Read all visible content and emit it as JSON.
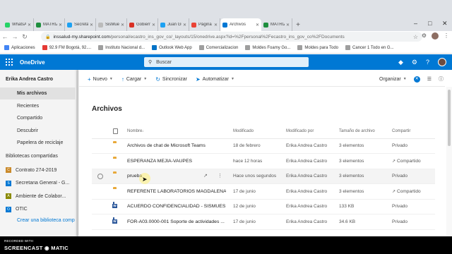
{
  "browser": {
    "tabs": [
      {
        "label": "WhatsAp",
        "color": "#25d366"
      },
      {
        "label": "MATRIZ",
        "color": "#1e8e3e"
      },
      {
        "label": "Secretari",
        "color": "#1da1f2"
      },
      {
        "label": "SisMuest",
        "color": "#bbbbbb"
      },
      {
        "label": "Gobierno",
        "color": "#d93025"
      },
      {
        "label": "Juan Guil",
        "color": "#1da1f2"
      },
      {
        "label": "Página p",
        "color": "#ea4335"
      },
      {
        "label": "Archivos",
        "color": "#0078d4"
      },
      {
        "label": "MATRIZ",
        "color": "#1e8e3e"
      }
    ],
    "active_tab_index": 7,
    "new_tab": "+",
    "url_host": "inssalud-my.sharepoint.com",
    "url_path": "/personal/ecastro_ins_gov_co/_layouts/15/onedrive.aspx?id=%2Fpersonal%2Fecastro_ins_gov_co%2FDocuments",
    "bookmarks": [
      {
        "label": "Aplicaciones",
        "color": "#4285f4"
      },
      {
        "label": "92.9 FM Bogotá, 92....",
        "color": "#e53935"
      },
      {
        "label": "Instituto Nacional d...",
        "color": "#9e9e9e"
      },
      {
        "label": "Outlook Web App",
        "color": "#0072c6"
      },
      {
        "label": "Comercializacion",
        "color": "#9e9e9e"
      },
      {
        "label": "Moldes Foamy Go...",
        "color": "#9e9e9e"
      },
      {
        "label": "Moldes para Todo",
        "color": "#9e9e9e"
      },
      {
        "label": "Cancer 1 Todo en G...",
        "color": "#9e9e9e"
      }
    ]
  },
  "suite": {
    "app_name": "OneDrive",
    "search_placeholder": "Buscar",
    "accent": "#0078d4"
  },
  "nav": {
    "user_name": "Erika Andrea Castro",
    "items": [
      {
        "label": "Mis archivos",
        "selected": true
      },
      {
        "label": "Recientes",
        "selected": false
      },
      {
        "label": "Compartido",
        "selected": false
      },
      {
        "label": "Descubrir",
        "selected": false
      },
      {
        "label": "Papelera de reciclaje",
        "selected": false
      }
    ],
    "shared_libraries_heading": "Bibliotecas compartidas",
    "sites": [
      {
        "label": "Contrato 274-2019",
        "letter": "C",
        "color": "#ca8a2b"
      },
      {
        "label": "Secretaria General - G...",
        "letter": "S",
        "color": "#0078d4"
      },
      {
        "label": "Ambiente de Colabor...",
        "letter": "A",
        "color": "#8a8a00"
      },
      {
        "label": "OTIC",
        "letter": "O",
        "color": "#0078d4"
      }
    ],
    "create_library": "Crear una biblioteca comp"
  },
  "commands": {
    "new": "Nuevo",
    "upload": "Cargar",
    "sync": "Sincronizar",
    "automate": "Automatizar",
    "sort": "Organizar"
  },
  "page_title": "Archivos",
  "columns": {
    "name": "Nombre",
    "modified": "Modificado",
    "modified_by": "Modificado por",
    "size": "Tamaño de archivo",
    "sharing": "Compartir"
  },
  "files": [
    {
      "type": "folder",
      "name": "Archivos de chat de Microsoft Teams",
      "modified": "18 de febrero",
      "by": "Erika Andrea Castro",
      "size": "3 elementos",
      "sharing": "Privado",
      "shared": false
    },
    {
      "type": "folder",
      "name": "ESPERANZA MEJÍA-VAUPÉS",
      "modified": "hace 12 horas",
      "by": "Erika Andrea Castro",
      "size": "3 elementos",
      "sharing": "Compartido",
      "shared": true
    },
    {
      "type": "folder",
      "name": "prueba",
      "modified": "Hace unos segundos",
      "by": "Erika Andrea Castro",
      "size": "3 elementos",
      "sharing": "Privado",
      "shared": false
    },
    {
      "type": "folder",
      "name": "REFERENTE LABORATORIOS MAGDALENA-...",
      "modified": "17 de junio",
      "by": "Erika Andrea Castro",
      "size": "3 elementos",
      "sharing": "Compartido",
      "shared": true
    },
    {
      "type": "word",
      "name": "ACUERDO CONFIDENCIALIDAD - SISMUES...",
      "modified": "12 de junio",
      "by": "Erika Andrea Castro",
      "size": "133 KB",
      "sharing": "Privado",
      "shared": false
    },
    {
      "type": "word",
      "name": "FOR-A03.0000-001 Soporte de actividades ...",
      "modified": "17 de junio",
      "by": "Erika Andrea Castro",
      "size": "34.6 KB",
      "sharing": "Privado",
      "shared": false
    }
  ],
  "watermark": {
    "line1": "RECORDED WITH",
    "line2": "SCREENCAST ◉ MATIC"
  }
}
